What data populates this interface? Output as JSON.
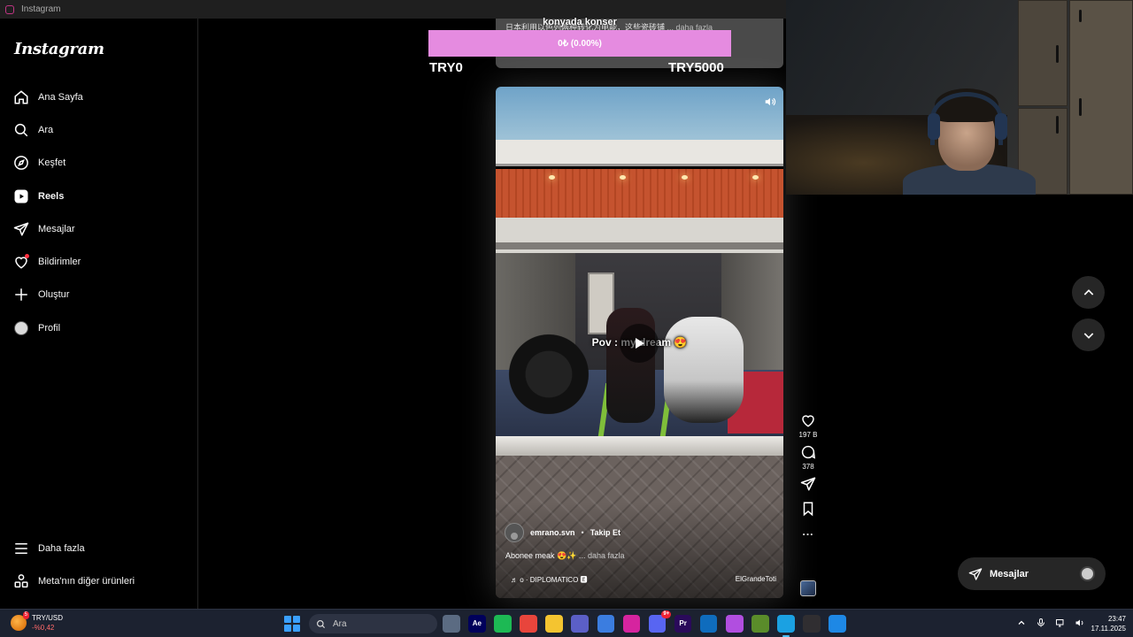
{
  "browser": {
    "tab_title": "Instagram"
  },
  "sidebar": {
    "logo": "Instagram",
    "items": [
      {
        "label": "Ana Sayfa",
        "icon": "home-icon"
      },
      {
        "label": "Ara",
        "icon": "search-icon"
      },
      {
        "label": "Keşfet",
        "icon": "compass-icon"
      },
      {
        "label": "Reels",
        "icon": "reels-icon",
        "active": true
      },
      {
        "label": "Mesajlar",
        "icon": "send-icon"
      },
      {
        "label": "Bildirimler",
        "icon": "heart-icon"
      },
      {
        "label": "Oluştur",
        "icon": "plus-icon"
      },
      {
        "label": "Profil",
        "icon": "avatar"
      }
    ],
    "bottom_items": [
      {
        "label": "Daha fazla",
        "icon": "menu-icon"
      },
      {
        "label": "Meta'nın diğer ürünleri",
        "icon": "meta-products-icon"
      }
    ]
  },
  "donation_overlay": {
    "title": "konyada konser",
    "progress_text": "0₺ (0.00%)",
    "progress_fraction": 0.0,
    "min_label": "TRY0",
    "max_label": "TRY5000",
    "bar_color": "#e58be0"
  },
  "previous_reel": {
    "caption": "日本利用以色列两种转化为电能，这些瓷砖铺",
    "more": "... daha fazla"
  },
  "reel": {
    "overlay_text": "Pov : my dream 😍",
    "author": "emrano.svn",
    "follow_label": "Takip Et",
    "caption": "Abonee meak 😍✨",
    "caption_more": "... daha fazla",
    "audio_title": "♬ o · DIPLOMATICO 🅴",
    "audio_artist": "ElGrandeToti",
    "likes": "197 B",
    "comments": "378",
    "menu": "..."
  },
  "right_nav": {
    "up_icon": "chevron-up-icon",
    "down_icon": "chevron-down-icon"
  },
  "messages_pill": {
    "label": "Mesajlar"
  },
  "taskbar": {
    "ticker_name": "TRY/USD",
    "ticker_change": "-%0,42",
    "badge": "5",
    "search_placeholder": "Ara",
    "discord_badge": "9+",
    "time": "23:47",
    "date": "17.11.2025",
    "apps": [
      {
        "name": "task-view-icon",
        "color": "#5b6b82",
        "label": ""
      },
      {
        "name": "after-effects-icon",
        "color": "#00005b",
        "label": "Ae"
      },
      {
        "name": "spotify-icon",
        "color": "#1db954",
        "label": ""
      },
      {
        "name": "chrome-icon",
        "color": "#e8453c",
        "label": ""
      },
      {
        "name": "file-explorer-icon",
        "color": "#f4c430",
        "label": ""
      },
      {
        "name": "teams-icon",
        "color": "#5b5fc7",
        "label": ""
      },
      {
        "name": "store-icon",
        "color": "#3b7de0",
        "label": ""
      },
      {
        "name": "instagram-icon",
        "color": "#d6249f",
        "label": ""
      },
      {
        "name": "discord-icon",
        "color": "#5865f2",
        "label": ""
      },
      {
        "name": "premiere-icon",
        "color": "#2a0a5a",
        "label": "Pr"
      },
      {
        "name": "mail-icon",
        "color": "#0f6cbd",
        "label": ""
      },
      {
        "name": "copilot-icon",
        "color": "#b14ee0",
        "label": ""
      },
      {
        "name": "minecraft-icon",
        "color": "#5a8c2a",
        "label": ""
      },
      {
        "name": "edge-icon",
        "color": "#1ba1e2",
        "label": "",
        "active": true
      },
      {
        "name": "obs-icon",
        "color": "#302e31",
        "label": ""
      },
      {
        "name": "app-icon",
        "color": "#1e88e5",
        "label": ""
      }
    ]
  }
}
